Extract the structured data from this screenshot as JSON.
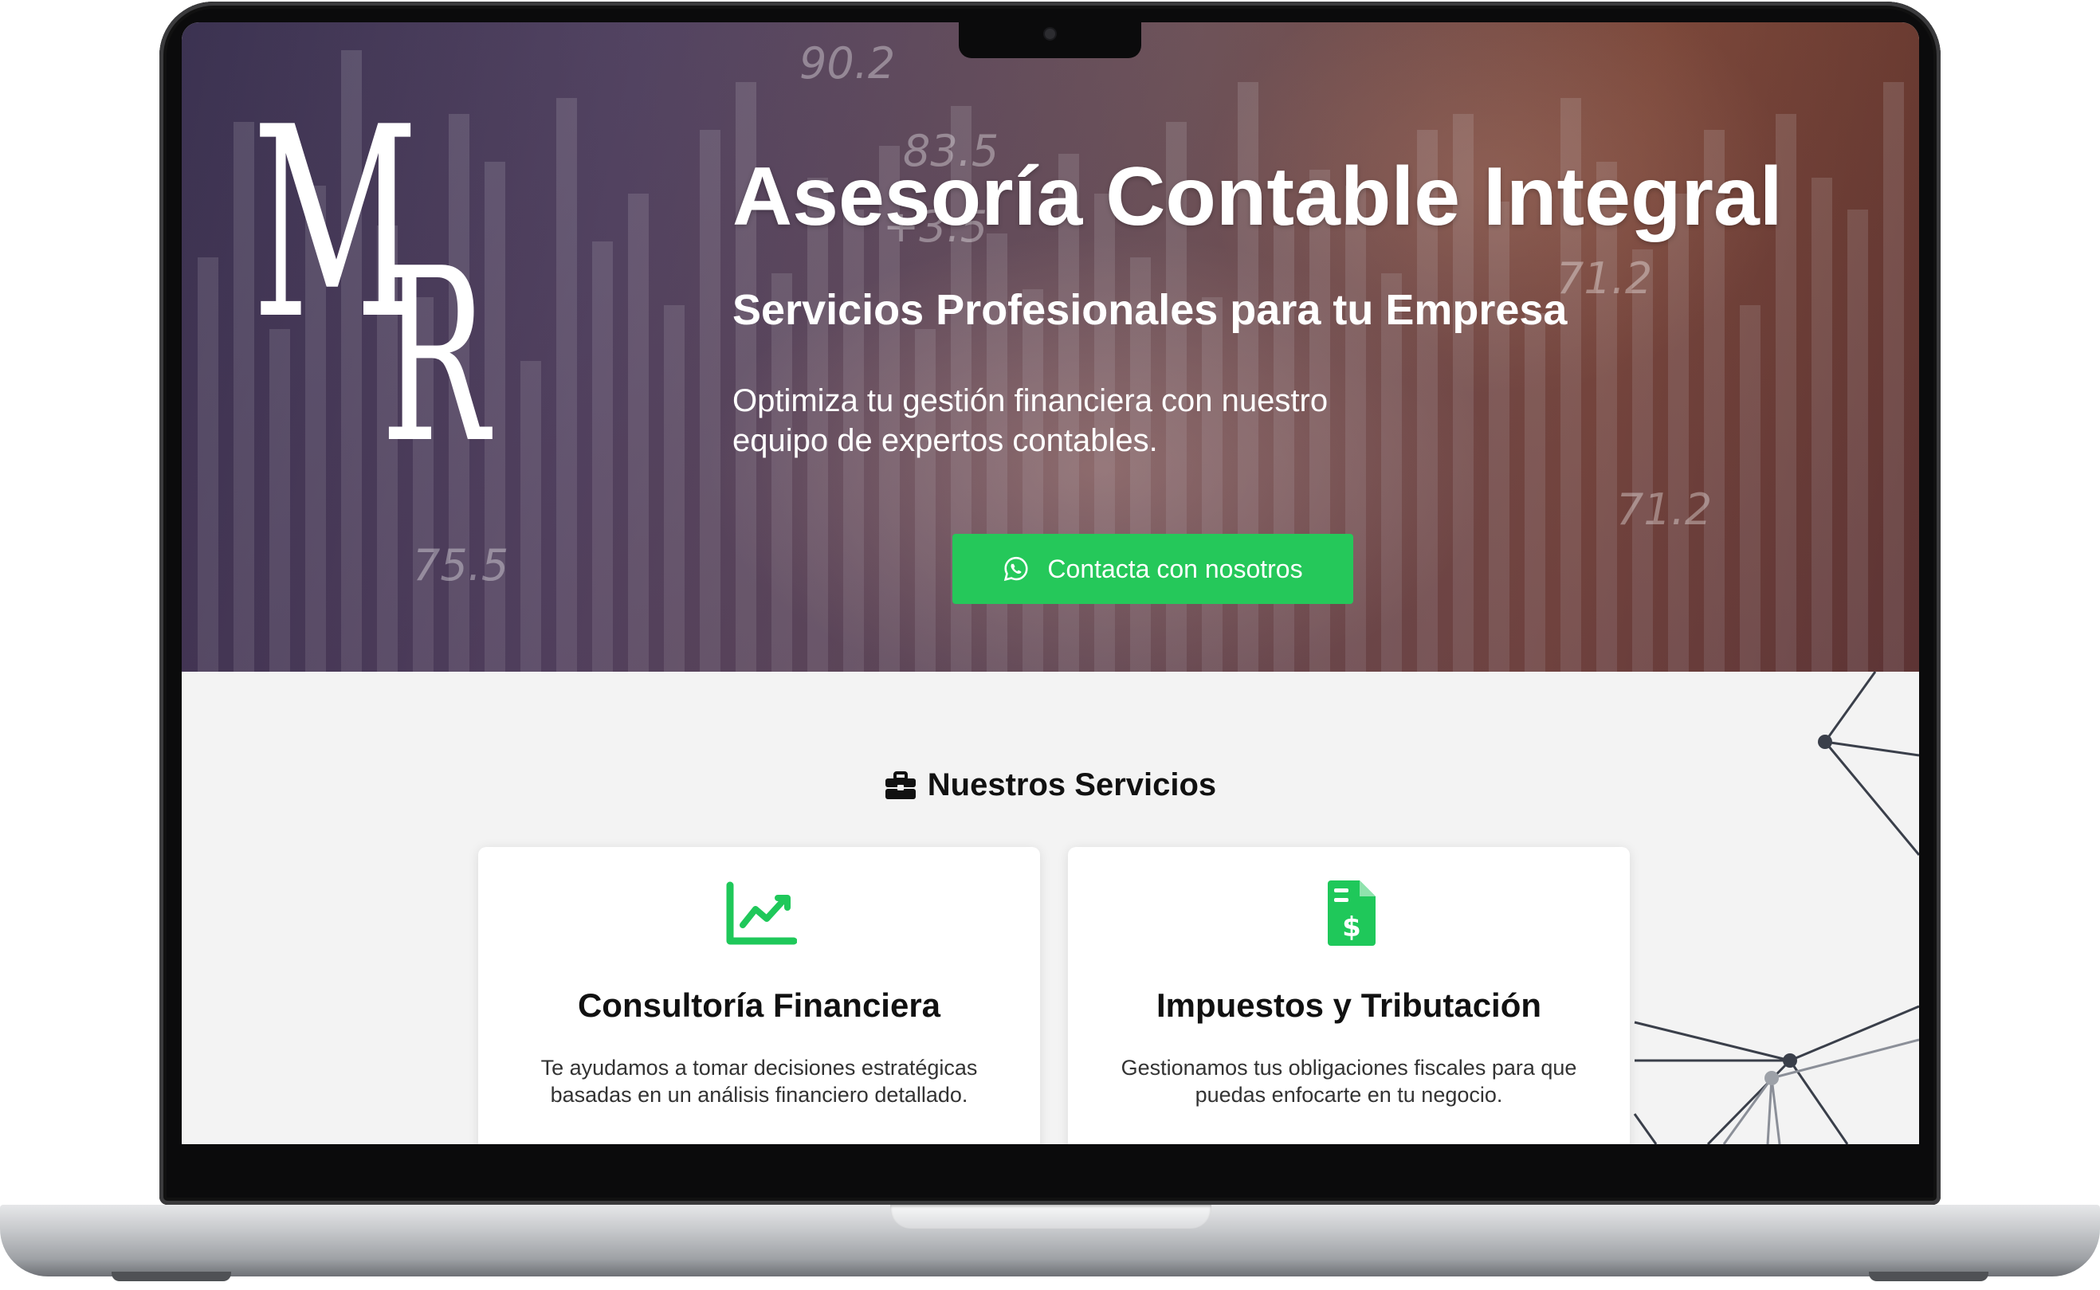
{
  "hero": {
    "logo_letters": [
      "M",
      "R"
    ],
    "title": "Asesoría Contable Integral",
    "subtitle": "Servicios Profesionales para tu Empresa",
    "description": "Optimiza tu gestión financiera con nuestro equipo de expertos contables.",
    "cta_label": "Contacta con nosotros",
    "cta_icon": "whatsapp-icon",
    "background_numbers": [
      "90.2",
      "83.5",
      "+3.5",
      "71.2",
      "71.2",
      "75.5"
    ]
  },
  "services": {
    "heading": "Nuestros Servicios",
    "heading_icon": "briefcase-icon",
    "items": [
      {
        "icon": "chart-line-icon",
        "title": "Consultoría Financiera",
        "text": "Te ayudamos a tomar decisiones estratégicas basadas en un análisis financiero detallado."
      },
      {
        "icon": "file-invoice-dollar-icon",
        "title": "Impuestos y Tributación",
        "text": "Gestionamos tus obligaciones fiscales para que puedas enfocarte en tu negocio."
      }
    ]
  },
  "colors": {
    "accent_green": "#25c85a",
    "icon_green": "#1fc85a",
    "section_bg": "#f3f3f3"
  }
}
